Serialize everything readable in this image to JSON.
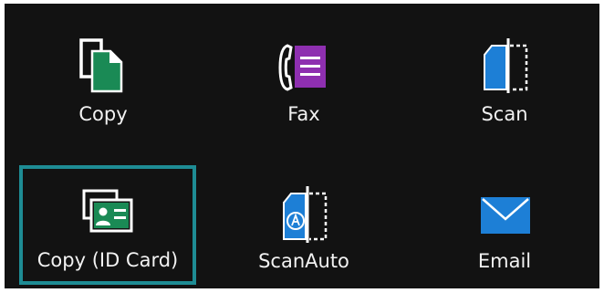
{
  "colors": {
    "background": "#121212",
    "selection_border": "#1e8c94",
    "copy_green": "#1a8a55",
    "fax_purple": "#8e2fb0",
    "scan_blue": "#1d7fd6",
    "id_card_green": "#1a8a55",
    "email_blue": "#1d7fd6"
  },
  "apps": [
    {
      "label": "Copy",
      "icon": "copy-icon",
      "selected": false
    },
    {
      "label": "Fax",
      "icon": "fax-icon",
      "selected": false
    },
    {
      "label": "Scan",
      "icon": "scan-icon",
      "selected": false
    },
    {
      "label": "Copy (ID Card)",
      "icon": "id-card-copy-icon",
      "selected": true
    },
    {
      "label": "ScanAuto",
      "icon": "scan-auto-icon",
      "selected": false
    },
    {
      "label": "Email",
      "icon": "envelope-icon",
      "selected": false
    }
  ]
}
